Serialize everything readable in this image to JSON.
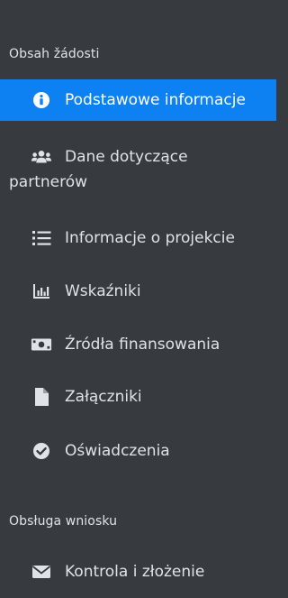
{
  "sections": {
    "request_content": "Obsah žádosti",
    "request_handling": "Obsługa wniosku"
  },
  "nav": {
    "basic_info": "Podstawowe informacje",
    "partners_line1": "Dane dotyczące",
    "partners_line2": "partnerów",
    "project_info": "Informacje o projekcie",
    "indicators": "Wskaźniki",
    "funding": "Źródła finansowania",
    "attachments": "Załączniki",
    "declarations": "Oświadczenia",
    "control_submit": "Kontrola i złożenie"
  },
  "colors": {
    "background": "#373b3f",
    "active": "#0d80f2",
    "text": "#dfe3e7"
  },
  "icons": {
    "basic_info": "info-circle-icon",
    "partners": "users-icon",
    "project_info": "list-icon",
    "indicators": "bar-chart-icon",
    "funding": "money-bill-icon",
    "attachments": "file-icon",
    "declarations": "check-circle-icon",
    "control_submit": "envelope-icon"
  }
}
